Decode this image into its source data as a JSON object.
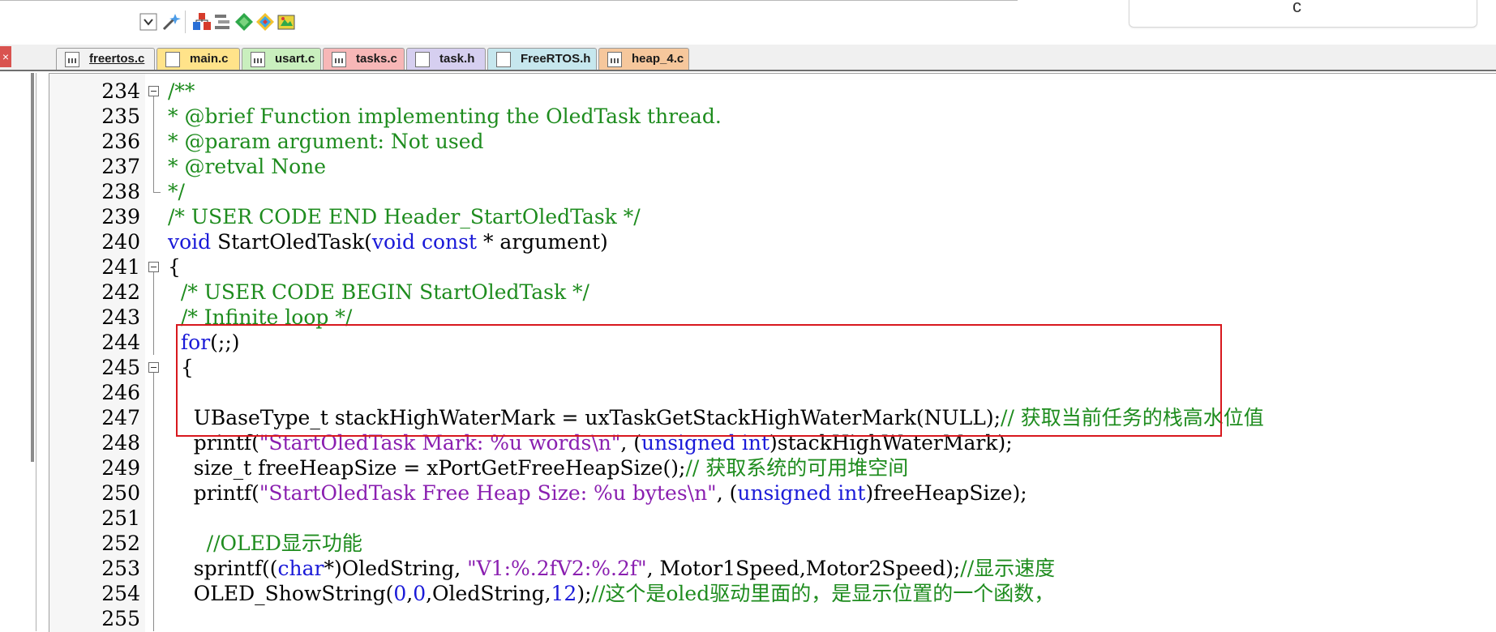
{
  "side_panel": {
    "text": "c"
  },
  "toolbar": {
    "icons": [
      "dropdown-icon",
      "wand-icon",
      "build-target-icon",
      "stack-icon",
      "diamond-green-icon",
      "diamond-multi-icon",
      "package-icon"
    ]
  },
  "tabs": [
    {
      "label": "freertos.c",
      "color": "#f2f2f2",
      "active": true,
      "icon": "c"
    },
    {
      "label": "main.c",
      "color": "#ffe38a",
      "active": false,
      "icon": "h"
    },
    {
      "label": "usart.c",
      "color": "#c9efbe",
      "active": false,
      "icon": "c"
    },
    {
      "label": "tasks.c",
      "color": "#f7b7b7",
      "active": false,
      "icon": "c"
    },
    {
      "label": "task.h",
      "color": "#d6cff0",
      "active": false,
      "icon": "h"
    },
    {
      "label": "FreeRTOS.h",
      "color": "#c6e7ee",
      "active": false,
      "icon": "h"
    },
    {
      "label": "heap_4.c",
      "color": "#f6c79c",
      "active": false,
      "icon": "c"
    }
  ],
  "code": {
    "lines": [
      {
        "num": "234",
        "fold": "open",
        "parts": [
          {
            "t": "/**",
            "c": "cm"
          }
        ]
      },
      {
        "num": "235",
        "fold": "line",
        "parts": [
          {
            "t": "* @brief Function implementing the OledTask thread.",
            "c": "cm"
          }
        ]
      },
      {
        "num": "236",
        "fold": "line",
        "parts": [
          {
            "t": "* @param argument: Not used",
            "c": "cm"
          }
        ]
      },
      {
        "num": "237",
        "fold": "line",
        "parts": [
          {
            "t": "* @retval None",
            "c": "cm"
          }
        ]
      },
      {
        "num": "238",
        "fold": "end",
        "parts": [
          {
            "t": "*/",
            "c": "cm"
          }
        ]
      },
      {
        "num": "239",
        "fold": "",
        "parts": [
          {
            "t": "/* USER CODE END Header_StartOledTask */",
            "c": "cm"
          }
        ]
      },
      {
        "num": "240",
        "fold": "",
        "parts": [
          {
            "t": "void",
            "c": "kw"
          },
          {
            "t": " StartOledTask(",
            "c": ""
          },
          {
            "t": "void const",
            "c": "kw"
          },
          {
            "t": " * argument)",
            "c": ""
          }
        ]
      },
      {
        "num": "241",
        "fold": "open",
        "parts": [
          {
            "t": "{",
            "c": ""
          }
        ]
      },
      {
        "num": "242",
        "fold": "line",
        "parts": [
          {
            "t": "  /* USER CODE BEGIN StartOledTask */",
            "c": "cm"
          }
        ]
      },
      {
        "num": "243",
        "fold": "line",
        "parts": [
          {
            "t": "  /* Infinite loop */",
            "c": "cm"
          }
        ]
      },
      {
        "num": "244",
        "fold": "line",
        "parts": [
          {
            "t": "  ",
            "c": ""
          },
          {
            "t": "for",
            "c": "kw"
          },
          {
            "t": "(;;)",
            "c": ""
          }
        ]
      },
      {
        "num": "245",
        "fold": "open",
        "parts": [
          {
            "t": "  {",
            "c": ""
          }
        ]
      },
      {
        "num": "246",
        "fold": "line",
        "parts": []
      },
      {
        "num": "247",
        "fold": "line",
        "parts": [
          {
            "t": "    UBaseType_t stackHighWaterMark = uxTaskGetStackHighWaterMark(NULL);",
            "c": ""
          },
          {
            "t": "// 获取当前任务的栈高水位值",
            "c": "cm"
          }
        ]
      },
      {
        "num": "248",
        "fold": "line",
        "parts": [
          {
            "t": "    printf(",
            "c": ""
          },
          {
            "t": "\"StartOledTask Mark: %u words\\n\"",
            "c": "st"
          },
          {
            "t": ", (",
            "c": ""
          },
          {
            "t": "unsigned int",
            "c": "kw"
          },
          {
            "t": ")stackHighWaterMark);",
            "c": ""
          }
        ]
      },
      {
        "num": "249",
        "fold": "line",
        "parts": [
          {
            "t": "    size_t freeHeapSize = xPortGetFreeHeapSize();",
            "c": ""
          },
          {
            "t": "// 获取系统的可用堆空间",
            "c": "cm"
          }
        ]
      },
      {
        "num": "250",
        "fold": "line",
        "parts": [
          {
            "t": "    printf(",
            "c": ""
          },
          {
            "t": "\"StartOledTask Free Heap Size: %u bytes\\n\"",
            "c": "st"
          },
          {
            "t": ", (",
            "c": ""
          },
          {
            "t": "unsigned int",
            "c": "kw"
          },
          {
            "t": ")freeHeapSize);",
            "c": ""
          }
        ]
      },
      {
        "num": "251",
        "fold": "line",
        "parts": []
      },
      {
        "num": "252",
        "fold": "line",
        "parts": [
          {
            "t": "      //OLED显示功能",
            "c": "cm"
          }
        ]
      },
      {
        "num": "253",
        "fold": "line",
        "parts": [
          {
            "t": "    sprintf((",
            "c": ""
          },
          {
            "t": "char",
            "c": "kw"
          },
          {
            "t": "*)OledString, ",
            "c": ""
          },
          {
            "t": "\"V1:%.2fV2:%.2f\"",
            "c": "st"
          },
          {
            "t": ", Motor1Speed,Motor2Speed);",
            "c": ""
          },
          {
            "t": "//显示速度",
            "c": "cm"
          }
        ]
      },
      {
        "num": "254",
        "fold": "line",
        "parts": [
          {
            "t": "    OLED_ShowString(",
            "c": ""
          },
          {
            "t": "0",
            "c": "nm"
          },
          {
            "t": ",",
            "c": ""
          },
          {
            "t": "0",
            "c": "nm"
          },
          {
            "t": ",OledString,",
            "c": ""
          },
          {
            "t": "12",
            "c": "nm"
          },
          {
            "t": ");",
            "c": ""
          },
          {
            "t": "//这个是oled驱动里面的，是显示位置的一个函数，",
            "c": "cm"
          }
        ]
      },
      {
        "num": "255",
        "fold": "line",
        "parts": []
      }
    ]
  }
}
